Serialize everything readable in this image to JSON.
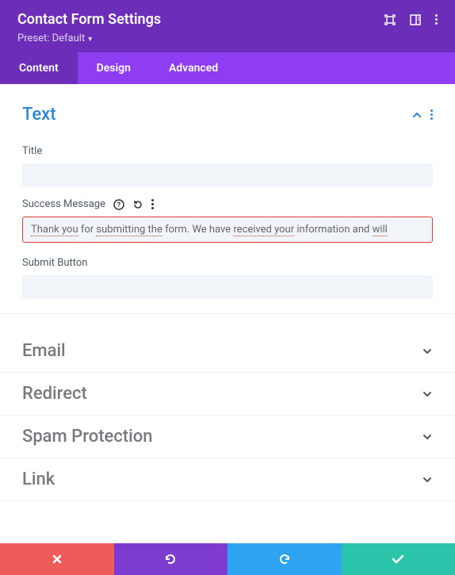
{
  "header": {
    "title": "Contact Form Settings",
    "preset_label": "Preset: Default"
  },
  "tabs": {
    "content": "Content",
    "design": "Design",
    "advanced": "Advanced"
  },
  "sections": {
    "text": {
      "title": "Text",
      "fields": {
        "title_label": "Title",
        "title_value": "",
        "success_label": "Success Message",
        "success_value": "Thank you for submitting the form. We have received your information and will",
        "submit_label": "Submit Button",
        "submit_value": ""
      }
    },
    "email": "Email",
    "redirect": "Redirect",
    "spam": "Spam Protection",
    "link": "Link"
  },
  "icons": {
    "expand": "expand-icon",
    "panel": "panel-icon",
    "more": "more-icon",
    "collapse": "collapse-icon",
    "help": "help-icon",
    "reset": "reset-icon",
    "chevron_down": "chevron-down",
    "cancel": "cancel",
    "undo": "undo",
    "redo": "redo",
    "save": "save"
  }
}
